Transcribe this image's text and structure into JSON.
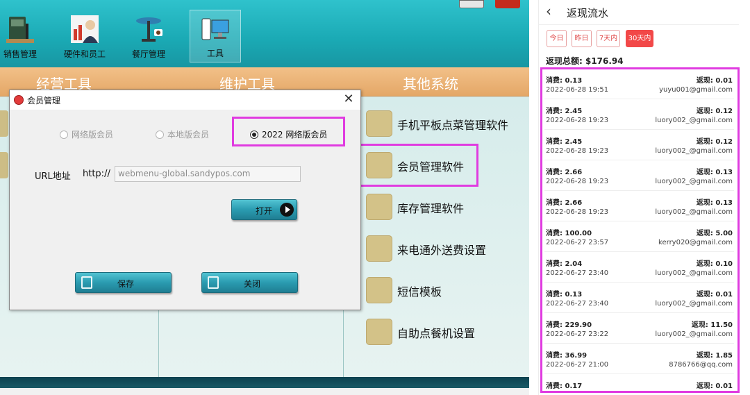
{
  "nav": {
    "items": [
      {
        "label": "销售管理",
        "icon": "sales-management-icon"
      },
      {
        "label": "硬件和员工",
        "icon": "hardware-staff-icon"
      },
      {
        "label": "餐厅管理",
        "icon": "restaurant-management-icon"
      },
      {
        "label": "工具",
        "icon": "tools-icon",
        "active": true
      }
    ]
  },
  "categories": [
    "经营工具",
    "维护工具",
    "其他系统"
  ],
  "systems": [
    "手机平板点菜管理软件",
    "会员管理软件",
    "库存管理软件",
    "来电通外送费设置",
    "短信模板",
    "自助点餐机设置"
  ],
  "dialog": {
    "title": "会员管理",
    "radios": [
      {
        "label": "网络版会员",
        "checked": false
      },
      {
        "label": "本地版会员",
        "checked": false
      },
      {
        "label": "2022 网络版会员",
        "checked": true
      }
    ],
    "url_label": "URL地址",
    "url_prefix": "http://",
    "url_value": "webmenu-global.sandypos.com",
    "open_label": "打开",
    "save_label": "保存",
    "close_label": "关闭"
  },
  "panel": {
    "title": "返现流水",
    "filters": [
      "今日",
      "昨日",
      "7天内",
      "30天内"
    ],
    "active_filter": "30天内",
    "total": "返现总额: $176.94",
    "records": [
      {
        "spend": "消费: 0.13",
        "cashback": "返现: 0.01",
        "time": "2022-06-28 19:51",
        "email": "yuyu001@gmail.com"
      },
      {
        "spend": "消费: 2.45",
        "cashback": "返现: 0.12",
        "time": "2022-06-28 19:23",
        "email": "luory002_@gmail.com"
      },
      {
        "spend": "消费: 2.45",
        "cashback": "返现: 0.12",
        "time": "2022-06-28 19:23",
        "email": "luory002_@gmail.com"
      },
      {
        "spend": "消费: 2.66",
        "cashback": "返现: 0.13",
        "time": "2022-06-28 19:23",
        "email": "luory002_@gmail.com"
      },
      {
        "spend": "消费: 2.66",
        "cashback": "返现: 0.13",
        "time": "2022-06-28 19:23",
        "email": "luory002_@gmail.com"
      },
      {
        "spend": "消费: 100.00",
        "cashback": "返现: 5.00",
        "time": "2022-06-27 23:57",
        "email": "kerry020@gmail.com"
      },
      {
        "spend": "消费: 2.04",
        "cashback": "返现: 0.10",
        "time": "2022-06-27 23:40",
        "email": "luory002_@gmail.com"
      },
      {
        "spend": "消费: 0.13",
        "cashback": "返现: 0.01",
        "time": "2022-06-27 23:40",
        "email": "luory002_@gmail.com"
      },
      {
        "spend": "消费: 229.90",
        "cashback": "返现: 11.50",
        "time": "2022-06-27 23:22",
        "email": "luory002_@gmail.com"
      },
      {
        "spend": "消费: 36.99",
        "cashback": "返现: 1.85",
        "time": "2022-06-27 21:00",
        "email": "8786766@qq.com"
      },
      {
        "spend": "消费: 0.17",
        "cashback": "返现: 0.01",
        "time": "",
        "email": ""
      }
    ]
  },
  "colors": {
    "highlight": "#e03be0",
    "accent_red": "#f24848",
    "teal": "#1aa9b4",
    "orange_bar": "#e4a767"
  }
}
